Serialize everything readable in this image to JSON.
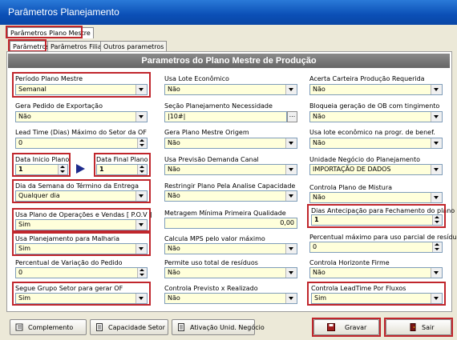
{
  "window": {
    "title": "Parâmetros Planejamento"
  },
  "top_tab": "Parâmetros Plano Mestre",
  "sub_tabs": [
    "Parâmetros",
    "Parâmetros Filial",
    "Outros parametros"
  ],
  "header": "Parametros do Plano Mestre de Produção",
  "col1": {
    "periodo": {
      "label": "Período Plano Mestre",
      "value": "Semanal"
    },
    "gera_pedido": {
      "label": "Gera Pedido de Exportação",
      "value": "Não"
    },
    "lead_time": {
      "label": "Lead Time (Dias) Máximo do Setor da OF",
      "value": "0"
    },
    "data_inicio": {
      "label": "Data Inicio Plano",
      "value": "1"
    },
    "data_final": {
      "label": "Data Final Plano",
      "value": "1"
    },
    "dia_semana": {
      "label": "Dia da Semana do Término da Entrega",
      "value": "Qualquer dia"
    },
    "usa_plano_op": {
      "label": "Usa Plano de Operações e Vendas [ P.O.V ]",
      "value": "Sim"
    },
    "usa_planejamento": {
      "label": "Usa Planejamento para Malharia",
      "value": "Sim"
    },
    "percentual": {
      "label": "Percentual de Variação do Pedido",
      "value": "0"
    },
    "segue_grupo": {
      "label": "Segue Grupo Setor para gerar OF",
      "value": "Sim"
    }
  },
  "col2": {
    "usa_lote": {
      "label": "Usa Lote Econômico",
      "value": "Não"
    },
    "secao": {
      "label": "Seção Planejamento Necessidade",
      "value": "|10#|",
      "button": "..."
    },
    "gera_plano_origem": {
      "label": "Gera Plano Mestre Origem",
      "value": "Não"
    },
    "usa_previsao": {
      "label": "Usa Previsão Demanda Canal",
      "value": "Não"
    },
    "restringir": {
      "label": "Restringir Plano Pela Analise Capacidade",
      "value": "Não"
    },
    "metragem": {
      "label": "Metragem Mínima Primeira Qualidade",
      "value": "0,00"
    },
    "calcula_mps": {
      "label": "Calcula MPS pelo valor máximo",
      "value": "Não"
    },
    "permite": {
      "label": "Permite uso total de resíduos",
      "value": "Não"
    },
    "controla_previsto": {
      "label": "Controla Previsto x Realizado",
      "value": "Não"
    }
  },
  "col3": {
    "acerta_carteira": {
      "label": "Acerta Carteira Produção Requerida",
      "value": "Não"
    },
    "bloqueia": {
      "label": "Bloqueia geração de OB com tingimento",
      "value": "Não"
    },
    "usa_lote_prog": {
      "label": "Usa lote econômico na progr. de benef.",
      "value": "Não"
    },
    "unidade": {
      "label": "Unidade Negócio do Planejamento",
      "value": "IMPORTAÇÃO DE DADOS"
    },
    "controla_plano": {
      "label": "Controla Plano de Mistura",
      "value": "Não"
    },
    "dias_antecipacao": {
      "label": "Dias Antecipação para Fechamento do plano",
      "value": "1"
    },
    "percentual_max": {
      "label": "Percentual máximo para uso parcial de resíduo",
      "value": "0"
    },
    "controla_horizonte": {
      "label": "Controla Horizonte Firme",
      "value": "Não"
    },
    "controla_leadtime": {
      "label": "Controla LeadTime Por Fluxos",
      "value": "Sim"
    }
  },
  "buttons": {
    "complemento": "Complemento",
    "capacidade": "Capacidade Setor",
    "ativacao": "Ativação Unid. Negócio",
    "gravar": "Gravar",
    "sair": "Sair"
  }
}
